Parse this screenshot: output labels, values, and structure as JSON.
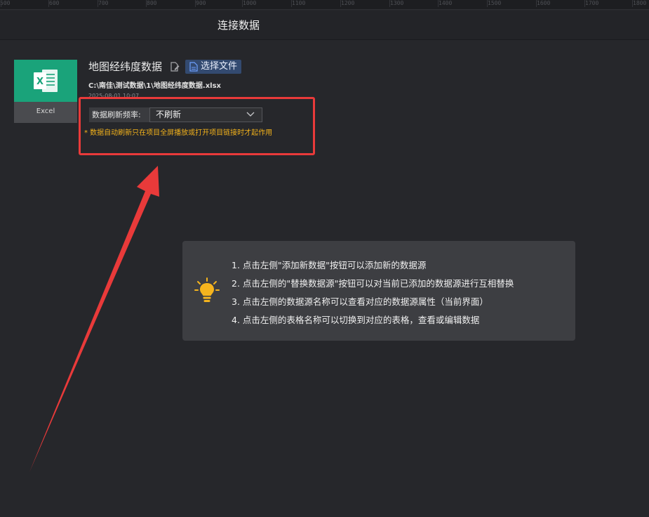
{
  "ruler": {
    "ticks": [
      "500",
      "600",
      "700",
      "800",
      "900",
      "1000",
      "1100",
      "1200",
      "1300",
      "1400",
      "1500",
      "1600",
      "1700",
      "1800"
    ]
  },
  "header": {
    "title": "连接数据"
  },
  "datasource": {
    "type_label": "Excel",
    "file_name": "地图经纬度数据",
    "choose_button": "选择文件",
    "file_path": "C:\\南佳\\测试数据\\1\\地图经纬度数据.xlsx",
    "file_time": "2025-08-01 10:07"
  },
  "refresh": {
    "label": "数据刷新频率:",
    "selected": "不刷新",
    "note": "* 数据自动刷新只在项目全屏播放或打开项目链接时才起作用"
  },
  "tips": {
    "items": [
      "1. 点击左侧\"添加新数据\"按钮可以添加新的数据源",
      "2. 点击左侧的\"替换数据源\"按钮可以对当前已添加的数据源进行互相替换",
      "3. 点击左侧的数据源名称可以查看对应的数据源属性（当前界面）",
      "4. 点击左侧的表格名称可以切换到对应的表格，查看或编辑数据"
    ]
  },
  "colors": {
    "background": "#26272b",
    "excel_green": "#1aa37a",
    "highlight_red": "#e93a3a",
    "note_orange": "#f3b21b",
    "button_blue": "#334a70"
  },
  "icons": [
    "excel-icon",
    "edit-icon",
    "document-icon",
    "chevron-down-icon",
    "lightbulb-icon",
    "red-arrow"
  ]
}
